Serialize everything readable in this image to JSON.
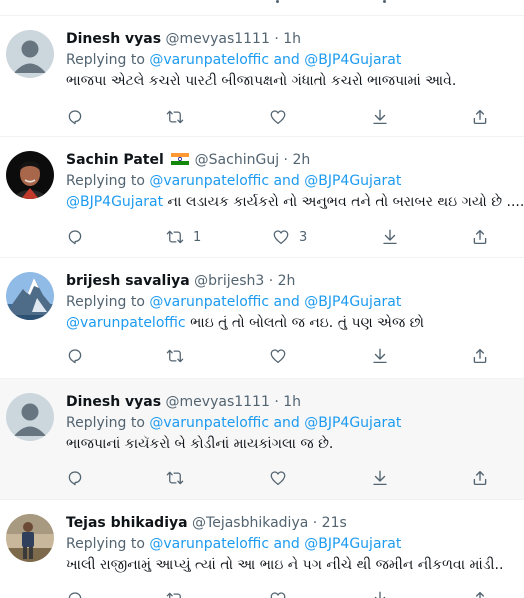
{
  "tweets": [
    {
      "name": "Dinesh vyas",
      "handle": "@mevyas1111",
      "time": "1h",
      "replying_label": "Replying to",
      "replying_links": "@varunpateloffic and @BJP4Gujarat",
      "mention": "",
      "text": "ભાજપા એટલે કચરો પારટી બીજાપક્ષનો ગંધાતો કચરો ભાજપામાં આવે.",
      "reply_count": "",
      "retweet_count": "",
      "like_count": "",
      "highlighted": false
    },
    {
      "name": "Sachin Patel",
      "handle": "@SachinGuj",
      "time": "2h",
      "replying_label": "Replying to",
      "replying_links": "@varunpateloffic and @BJP4Gujarat",
      "mention": "@BJP4Gujarat",
      "text": " ના લડાયક કાર્યકરો નો અનુભવ તને તો બરાબર થઇ ગયો છે ....",
      "reply_count": "",
      "retweet_count": "1",
      "like_count": "3",
      "highlighted": false
    },
    {
      "name": "brijesh savaliya",
      "handle": "@brijesh3",
      "time": "2h",
      "replying_label": "Replying to",
      "replying_links": "@varunpateloffic and @BJP4Gujarat",
      "mention": "@varunpateloffic",
      "text": " ભાઇ તું તો બોલતો જ નઇ. તું પણ એજ છો",
      "reply_count": "",
      "retweet_count": "",
      "like_count": "",
      "highlighted": false
    },
    {
      "name": "Dinesh vyas",
      "handle": "@mevyas1111",
      "time": "1h",
      "replying_label": "Replying to",
      "replying_links": "@varunpateloffic and @BJP4Gujarat",
      "mention": "",
      "text": "ભાજપાનાં કાયૅકરો બે કોડીનાં માયકાંગલા જ છે.",
      "reply_count": "",
      "retweet_count": "",
      "like_count": "",
      "highlighted": true
    },
    {
      "name": "Tejas bhikadiya",
      "handle": "@Tejasbhikadiya",
      "time": "21s",
      "replying_label": "Replying to",
      "replying_links": "@varunpateloffic and @BJP4Gujarat",
      "mention": "",
      "text": "ખાલી રાજીનામું આપ્યું ત્યાં તો આ ભાઇ ને પગ નીચે થી જમીન નીકળવા માંડી..",
      "reply_count": "",
      "retweet_count": "",
      "like_count": "",
      "highlighted": false
    }
  ],
  "colors": {
    "link": "#1d9bf0",
    "muted": "#536471",
    "text": "#0f1419",
    "divider": "#eff3f4",
    "highlight_bg": "#f7f7f7"
  },
  "icons": [
    "reply-icon",
    "retweet-icon",
    "like-icon",
    "download-icon",
    "share-icon",
    "india-flag-icon",
    "default-avatar-icon"
  ]
}
